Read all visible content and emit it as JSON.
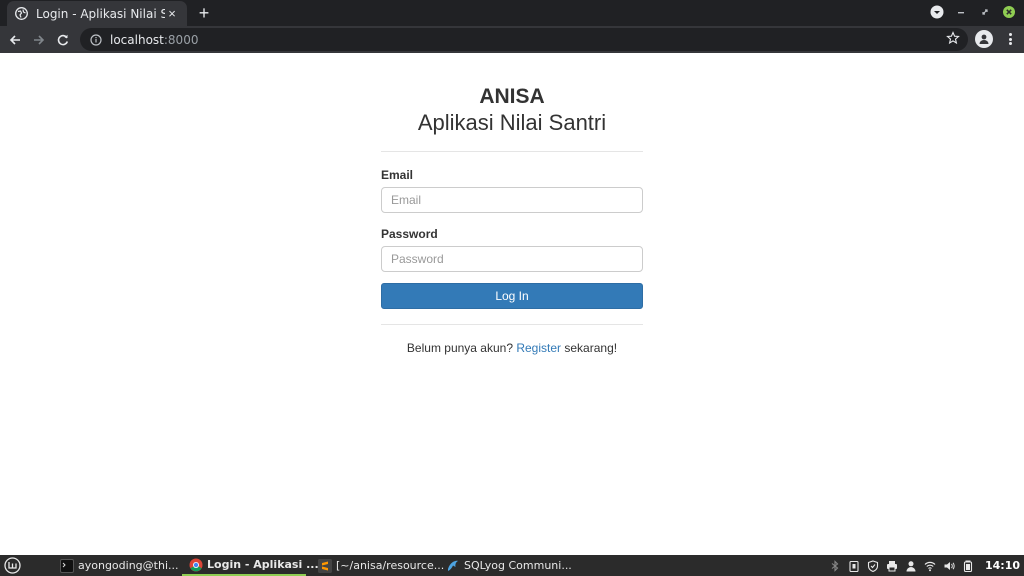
{
  "browser": {
    "tab_title": "Login - Aplikasi Nilai Santri",
    "tab_close": "×",
    "new_tab": "+",
    "url_host": "localhost",
    "url_port": ":8000"
  },
  "page": {
    "brand_title": "ANISA",
    "brand_subtitle": "Aplikasi Nilai Santri",
    "email_label": "Email",
    "email_placeholder": "Email",
    "email_value": "",
    "password_label": "Password",
    "password_placeholder": "Password",
    "password_value": "",
    "login_button": "Log In",
    "register_prefix": "Belum punya akun?",
    "register_link": "Register",
    "register_suffix": "sekarang!"
  },
  "taskbar": {
    "items": [
      {
        "label": "ayongoding@thi...",
        "icon": "terminal-icon"
      },
      {
        "label": "Login - Aplikasi ...",
        "icon": "chrome-icon"
      },
      {
        "label": "[~/anisa/resource...",
        "icon": "sublime-text-icon"
      },
      {
        "label": "SQLyog Communi...",
        "icon": "sqlyog-dolphin-icon"
      }
    ],
    "clock": "14:10"
  },
  "colors": {
    "accent": "#337ab7",
    "browser_frame": "#202124",
    "taskbar_active_underline": "#8fcd52"
  }
}
